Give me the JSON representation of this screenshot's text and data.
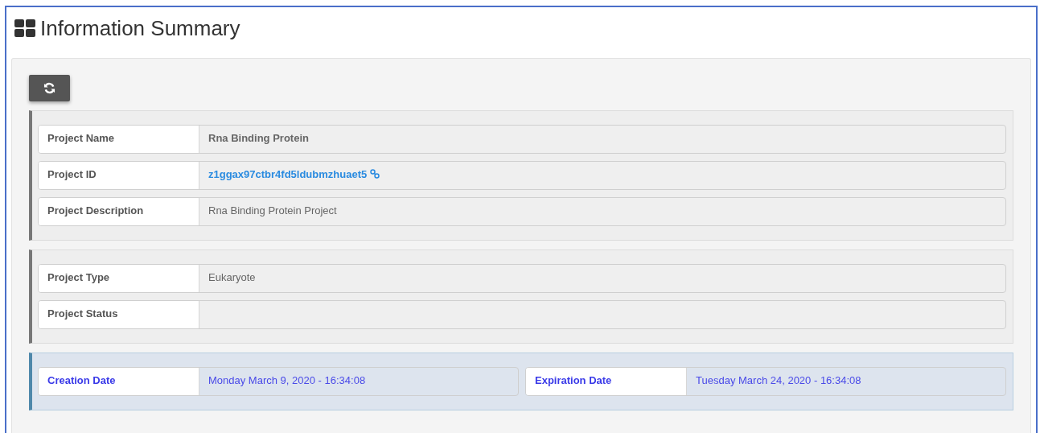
{
  "title": "Information Summary",
  "groups": [
    {
      "kind": "default",
      "rows": [
        {
          "label": "Project Name",
          "value": "Rna Binding Protein",
          "kind": "bold"
        },
        {
          "label": "Project ID",
          "value": "z1ggax97ctbr4fd5ldubmzhuaet5",
          "kind": "link"
        },
        {
          "label": "Project Description",
          "value": "Rna Binding Protein Project",
          "kind": "plain"
        }
      ]
    },
    {
      "kind": "default",
      "rows": [
        {
          "label": "Project Type",
          "value": "Eukaryote",
          "kind": "plain"
        },
        {
          "label": "Project Status",
          "kind": "plain"
        }
      ]
    },
    {
      "kind": "info",
      "rows": [
        {
          "label": "Creation Date",
          "value": "Monday March 9, 2020 - 16:34:08",
          "kind": "plain"
        },
        {
          "label": "Expiration Date",
          "value": "Tuesday March 24, 2020 - 16:34:08",
          "kind": "plain"
        }
      ]
    }
  ]
}
